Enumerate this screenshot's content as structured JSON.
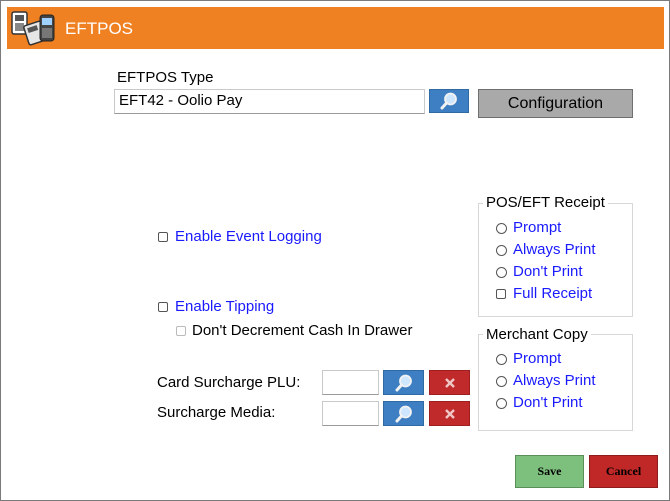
{
  "window": {
    "title": "EFTPOS",
    "icon": "eftpos-terminal-icon"
  },
  "eftpos_type": {
    "label": "EFTPOS Type",
    "value": "EFT42 - Oolio Pay",
    "configuration_label": "Configuration"
  },
  "options": {
    "enable_event_logging": "Enable Event Logging",
    "enable_tipping": "Enable Tipping",
    "dont_decrement_cash": "Don't Decrement Cash In Drawer"
  },
  "surcharge": {
    "card_plu_label": "Card Surcharge PLU:",
    "card_plu_value": "",
    "media_label": "Surcharge Media:",
    "media_value": ""
  },
  "pos_receipt": {
    "title": "POS/EFT Receipt",
    "prompt": "Prompt",
    "always_print": "Always Print",
    "dont_print": "Don't Print",
    "full_receipt": "Full Receipt"
  },
  "merchant_copy": {
    "title": "Merchant Copy",
    "prompt": "Prompt",
    "always_print": "Always Print",
    "dont_print": "Don't Print"
  },
  "buttons": {
    "save": "Save",
    "cancel": "Cancel"
  },
  "colors": {
    "titlebar": "#f08122",
    "search": "#3d7fc2",
    "clear": "#c12a2a",
    "save": "#7dbf7d",
    "cancel": "#c02828",
    "link_text": "#1a1aff"
  }
}
